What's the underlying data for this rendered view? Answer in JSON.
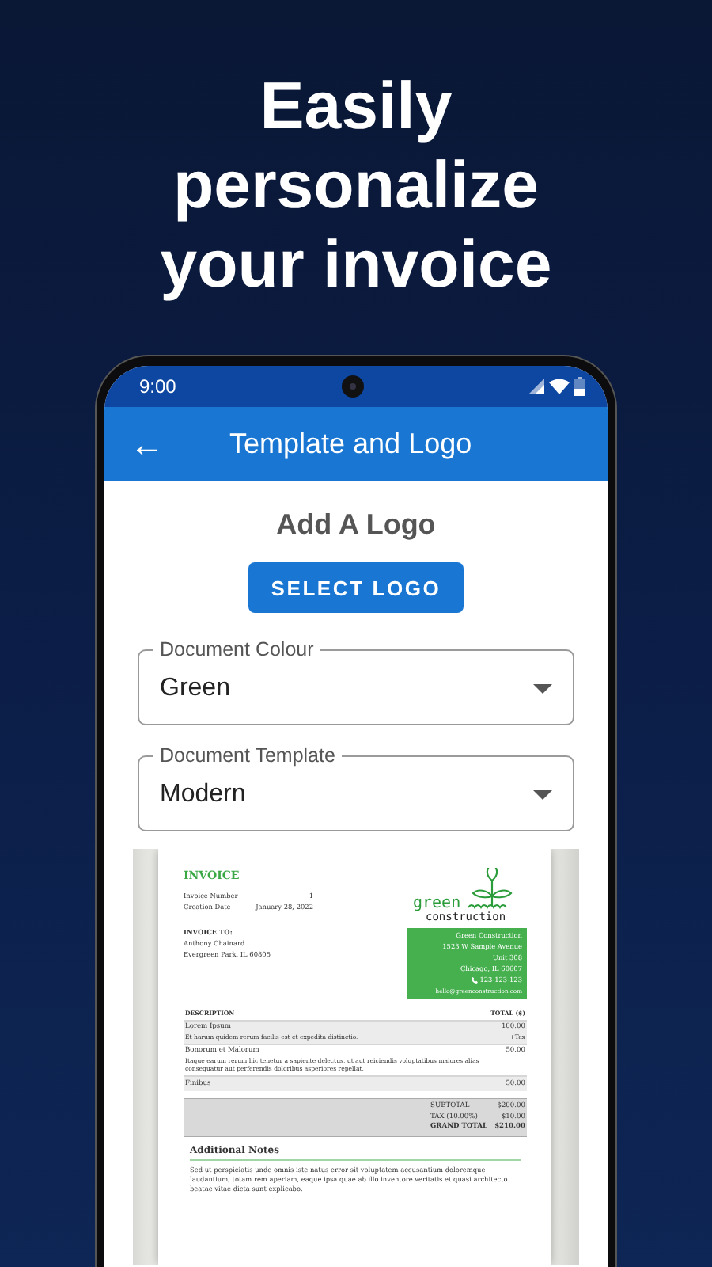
{
  "headline": "Easily personalize your invoice",
  "status_bar": {
    "time": "9:00"
  },
  "app_bar": {
    "back_icon": "←",
    "title": "Template and Logo"
  },
  "logo_section": {
    "heading": "Add A Logo",
    "button": "SELECT LOGO"
  },
  "fields": [
    {
      "label": "Document Colour",
      "value": "Green"
    },
    {
      "label": "Document Template",
      "value": "Modern"
    }
  ],
  "invoice": {
    "title": "INVOICE",
    "meta": [
      {
        "label": "Invoice Number",
        "value": "1"
      },
      {
        "label": "Creation Date",
        "value": "January 28, 2022"
      }
    ],
    "bill_to_label": "INVOICE TO:",
    "bill_to_lines": [
      "Anthony Chainard",
      "Evergreen Park, IL 60805"
    ],
    "logo": {
      "top": "green",
      "bottom": "construction"
    },
    "company_lines": [
      "Green Construction",
      "1523 W Sample Avenue",
      "Unit 308",
      "Chicago, IL 60607"
    ],
    "phone": "123-123-123",
    "email": "hello@greenconstruction.com",
    "columns": [
      "DESCRIPTION",
      "TOTAL ($)"
    ],
    "items": [
      {
        "name": "Lorem Ipsum",
        "description": "Et harum quidem rerum facilis est et expedita distinctio.",
        "amount": "100.00",
        "note": "+Tax",
        "shaded": true
      },
      {
        "name": "Bonorum et Malorum",
        "description": "Itaque earum rerum hic tenetur a sapiente delectus, ut aut reiciendis voluptatibus maiores alias consequatur aut perferendis doloribus asperiores repellat.",
        "amount": "50.00",
        "shaded": false
      },
      {
        "name": "Finibus",
        "amount": "50.00",
        "shaded": true
      }
    ],
    "totals": [
      {
        "label": "SUBTOTAL",
        "value": "$200.00",
        "bold": false
      },
      {
        "label": "TAX (10.00%)",
        "value": "$10.00",
        "bold": false
      },
      {
        "label": "GRAND TOTAL",
        "value": "$210.00",
        "bold": true
      }
    ],
    "notes_title": "Additional Notes",
    "notes_text": "Sed ut perspiciatis unde omnis iste natus error sit voluptatem accusantium doloremque laudantium, totam rem aperiam, eaque ipsa quae ab illo inventore veritatis et quasi architecto beatae vitae dicta sunt explicabo."
  }
}
